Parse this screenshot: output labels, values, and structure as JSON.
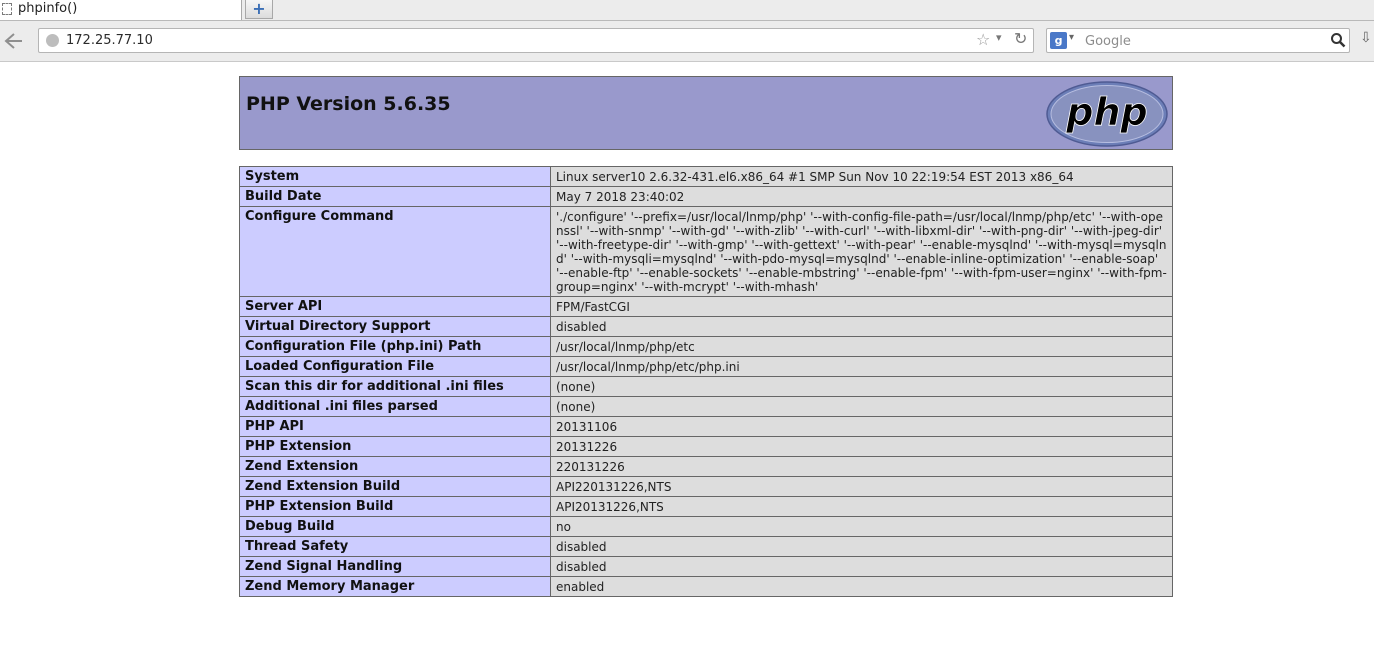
{
  "browser": {
    "tab_title": "phpinfo()",
    "newtab_label": "+",
    "url": "172.25.77.10",
    "search_placeholder": "Google",
    "search_engine_letter": "g"
  },
  "page": {
    "version_title": "PHP Version 5.6.35",
    "logo_text": "php",
    "rows": [
      {
        "key": "System",
        "value": "Linux server10 2.6.32-431.el6.x86_64 #1 SMP Sun Nov 10 22:19:54 EST 2013 x86_64"
      },
      {
        "key": "Build Date",
        "value": "May 7 2018 23:40:02"
      },
      {
        "key": "Configure Command",
        "value": "'./configure' '--prefix=/usr/local/lnmp/php' '--with-config-file-path=/usr/local/lnmp/php/etc' '--with-openssl' '--with-snmp' '--with-gd' '--with-zlib' '--with-curl' '--with-libxml-dir' '--with-png-dir' '--with-jpeg-dir' '--with-freetype-dir' '--with-gmp' '--with-gettext' '--with-pear' '--enable-mysqlnd' '--with-mysql=mysqlnd' '--with-mysqli=mysqlnd' '--with-pdo-mysql=mysqlnd' '--enable-inline-optimization' '--enable-soap' '--enable-ftp' '--enable-sockets' '--enable-mbstring' '--enable-fpm' '--with-fpm-user=nginx' '--with-fpm-group=nginx' '--with-mcrypt' '--with-mhash'"
      },
      {
        "key": "Server API",
        "value": "FPM/FastCGI"
      },
      {
        "key": "Virtual Directory Support",
        "value": "disabled"
      },
      {
        "key": "Configuration File (php.ini) Path",
        "value": "/usr/local/lnmp/php/etc"
      },
      {
        "key": "Loaded Configuration File",
        "value": "/usr/local/lnmp/php/etc/php.ini"
      },
      {
        "key": "Scan this dir for additional .ini files",
        "value": "(none)"
      },
      {
        "key": "Additional .ini files parsed",
        "value": "(none)"
      },
      {
        "key": "PHP API",
        "value": "20131106"
      },
      {
        "key": "PHP Extension",
        "value": "20131226"
      },
      {
        "key": "Zend Extension",
        "value": "220131226"
      },
      {
        "key": "Zend Extension Build",
        "value": "API220131226,NTS"
      },
      {
        "key": "PHP Extension Build",
        "value": "API20131226,NTS"
      },
      {
        "key": "Debug Build",
        "value": "no"
      },
      {
        "key": "Thread Safety",
        "value": "disabled"
      },
      {
        "key": "Zend Signal Handling",
        "value": "disabled"
      },
      {
        "key": "Zend Memory Manager",
        "value": "enabled"
      }
    ]
  }
}
